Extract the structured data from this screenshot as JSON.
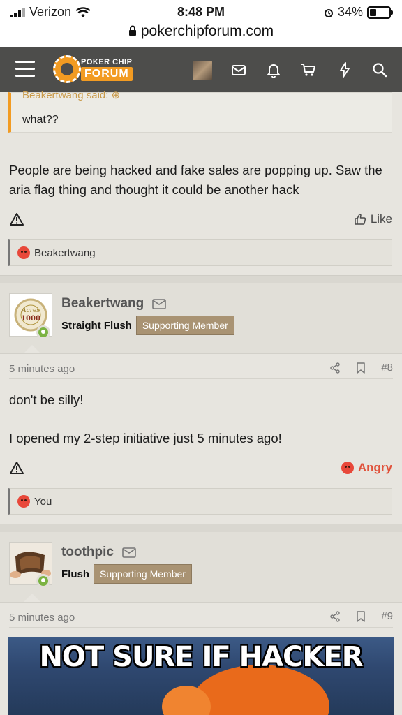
{
  "status_bar": {
    "carrier": "Verizon",
    "time": "8:48 PM",
    "battery": "34%",
    "battery_level": 0.34,
    "url": "pokerchipforum.com"
  },
  "nav": {
    "logo_top": "POKER CHIP",
    "logo_bottom": "FORUM",
    "icons": [
      "menu-icon",
      "avatar-thumb",
      "mail-icon",
      "bell-icon",
      "cart-icon",
      "bolt-icon",
      "search-icon"
    ]
  },
  "quote": {
    "attribution": "Beakertwang said:",
    "text": "what??"
  },
  "post1": {
    "text": "People are being hacked and fake sales are popping up. Saw the aria flag thing and thought it could be another hack",
    "like_label": "Like",
    "reactions": "Beakertwang"
  },
  "post2": {
    "username": "Beakertwang",
    "rank": "Straight Flush",
    "badge": "Supporting Member",
    "time": "5 minutes ago",
    "number": "#8",
    "line1": "don't be silly!",
    "line2": "I opened my 2-step initiative just 5 minutes ago!",
    "reaction_label": "Angry",
    "reactions": "You",
    "avatar_text": "1000"
  },
  "post3": {
    "username": "toothpic",
    "rank": "Flush",
    "badge": "Supporting Member",
    "time": "5 minutes ago",
    "number": "#9",
    "meme_text": "NOT SURE IF HACKER"
  }
}
